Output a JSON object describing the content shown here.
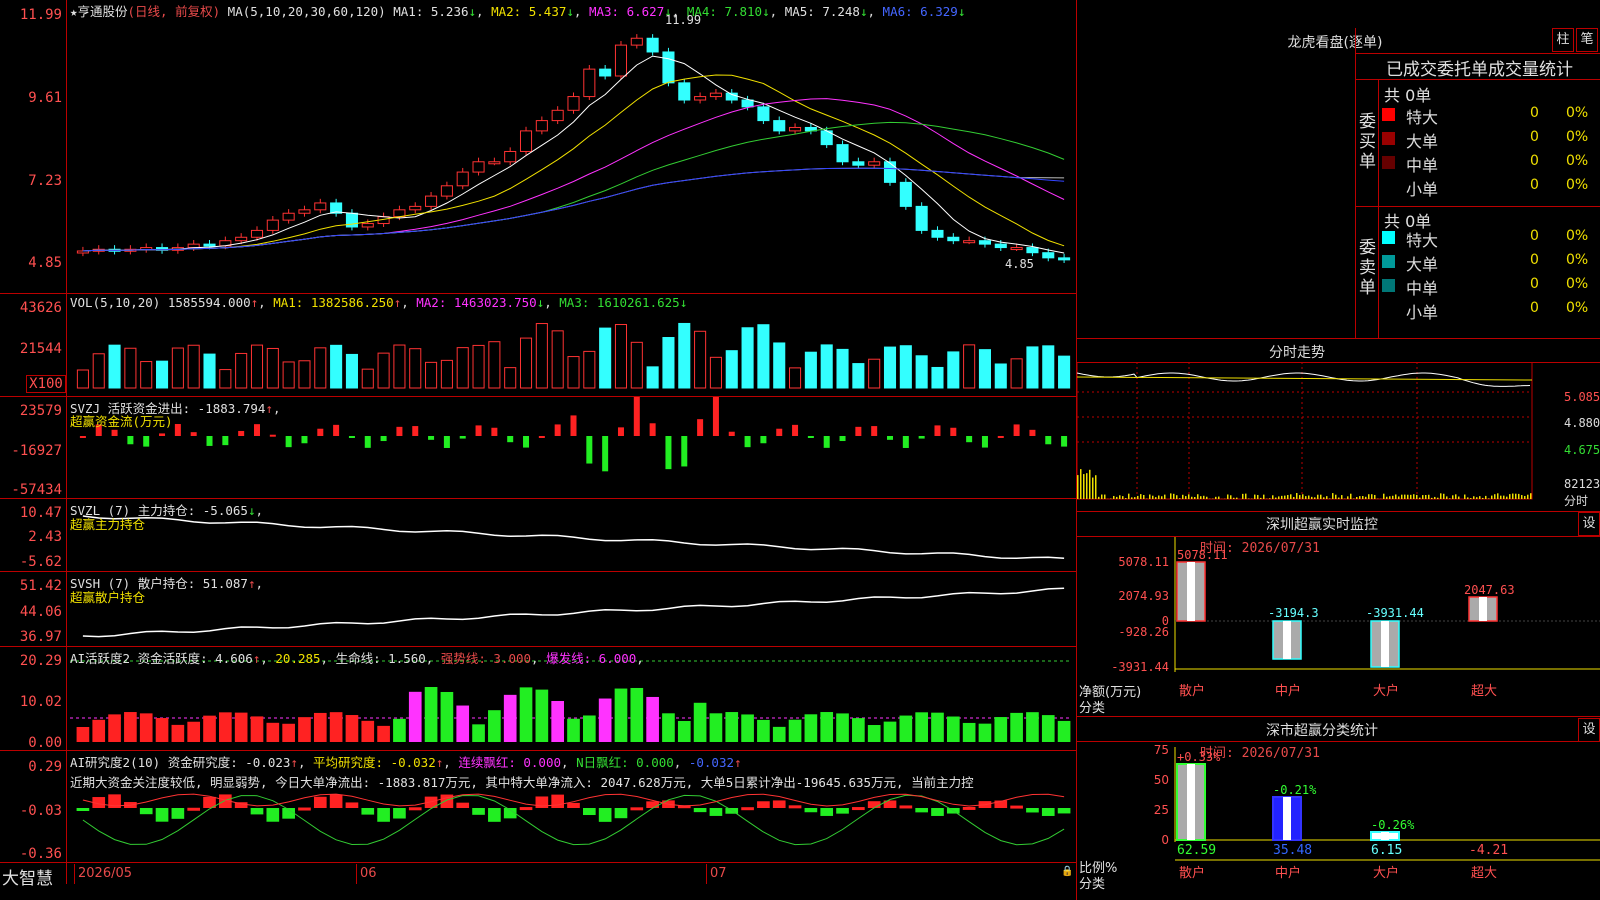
{
  "stock": {
    "name": "★亨通股份",
    "mode": "(日线, 前复权)"
  },
  "ma": {
    "label": "MA(5,10,20,30,60,120)",
    "ma1": "MA1: 5.236",
    "ma2": "MA2: 5.437",
    "ma3": "MA3: 6.627",
    "ma4": "MA4: 7.810",
    "ma5": "MA5: 7.248",
    "ma6": "MA6: 6.329",
    "high_mark": "11.99",
    "low_mark": "4.85"
  },
  "price_axis": [
    "11.99",
    "9.61",
    "7.23",
    "4.85"
  ],
  "vol": {
    "label": "VOL(5,10,20)",
    "val": "1585594.000",
    "ma1": "MA1: 1382586.250",
    "ma2": "MA2: 1463023.750",
    "ma3": "MA3: 1610261.625",
    "axis": [
      "43626",
      "21544",
      "X100"
    ]
  },
  "svzj": {
    "label": "SVZJ  活跃资金进出: -1883.794",
    "sub": "超赢资金流(万元)",
    "axis": [
      "23579",
      "-16927",
      "-57434"
    ]
  },
  "svzl": {
    "label": "SVZL (7) 主力持仓: -5.065",
    "sub": "超赢主力持仓",
    "axis": [
      "10.47",
      "2.43",
      "-5.62"
    ]
  },
  "svsh": {
    "label": "SVSH (7) 散户持仓: 51.087",
    "sub": "超赢散户持仓",
    "axis": [
      "51.42",
      "44.06",
      "36.97"
    ]
  },
  "ai1": {
    "label": "AI活跃度2 资金活跃度: 4.606",
    "v2": "20.285",
    "v3": "生命线: 1.560",
    "v4": "强势线: 3.000",
    "v5": "爆发线: 6.000",
    "axis": [
      "20.29",
      "10.02",
      "0.00"
    ]
  },
  "ai2": {
    "label": "AI研究度2(10) 资金研究度: -0.023",
    "v2": "平均研究度: -0.032",
    "v3": "连续飘红: 0.000",
    "v4": "N日飘红: 0.000",
    "v5": "-0.032",
    "axis": [
      "0.29",
      "-0.03",
      "-0.36"
    ],
    "comment": "近期大资金关注度较低, 明显弱势, 今日大单净流出: -1883.817万元, 其中特大单净流入: 2047.628万元, 大单5日累计净出-19645.635万元, 当前主力控"
  },
  "footer": {
    "brand": "大智慧",
    "d1": "2026/05",
    "d2": "06",
    "d3": "07"
  },
  "lhkp": {
    "title": "龙虎看盘(逐单)",
    "btn1": "柱",
    "btn2": "笔",
    "subtitle": "已成交委托单成交量统计",
    "buy": {
      "label": "委买单",
      "total": "共 0单",
      "rows": [
        {
          "name": "特大",
          "v": "0",
          "p": "0%",
          "color": "#ff0000"
        },
        {
          "name": "大单",
          "v": "0",
          "p": "0%",
          "color": "#990000"
        },
        {
          "name": "中单",
          "v": "0",
          "p": "0%",
          "color": "#660000"
        },
        {
          "name": "小单",
          "v": "0",
          "p": "0%",
          "color": "#000000"
        }
      ]
    },
    "sell": {
      "label": "委卖单",
      "total": "共 0单",
      "rows": [
        {
          "name": "特大",
          "v": "0",
          "p": "0%",
          "color": "#00ffff"
        },
        {
          "name": "大单",
          "v": "0",
          "p": "0%",
          "color": "#009999"
        },
        {
          "name": "中单",
          "v": "0",
          "p": "0%",
          "color": "#007777"
        },
        {
          "name": "小单",
          "v": "0",
          "p": "0%",
          "color": "#000000"
        }
      ]
    }
  },
  "fenshi": {
    "title": "分时走势",
    "axis": [
      "5.085",
      "4.880",
      "4.675",
      "82123",
      "分时"
    ]
  },
  "sz_monitor": {
    "title": "深圳超赢实时监控",
    "btn": "设",
    "time": "时间: 2026/07/31",
    "axis": [
      "5078.11",
      "2074.93",
      "0",
      "-928.26",
      "-3931.44"
    ],
    "ylabel": "净额(万元)",
    "xlabel": "分类",
    "bars": [
      {
        "cat": "散户",
        "val": "5078.11"
      },
      {
        "cat": "中户",
        "val": "-3194.3"
      },
      {
        "cat": "大户",
        "val": "-3931.44"
      },
      {
        "cat": "超大",
        "val": "2047.63"
      }
    ]
  },
  "sz_class": {
    "title": "深市超赢分类统计",
    "btn": "设",
    "time": "时间: 2026/07/31",
    "axis": [
      "75",
      "50",
      "25",
      "0"
    ],
    "ylabel": "比例%",
    "xlabel": "分类",
    "bars": [
      {
        "cat": "散户",
        "top": "+0.33%",
        "bottom": "62.59"
      },
      {
        "cat": "中户",
        "top": "-0.21%",
        "bottom": "35.48"
      },
      {
        "cat": "大户",
        "top": "-0.26%",
        "bottom": "6.15"
      },
      {
        "cat": "超大",
        "top": "",
        "bottom": "-4.21"
      }
    ]
  },
  "chart_data": [
    {
      "type": "candlestick",
      "title": "亨通股份 日线",
      "ylim": [
        4.85,
        11.99
      ],
      "series": [
        {
          "name": "MA1",
          "last": 5.236
        },
        {
          "name": "MA2",
          "last": 5.437
        },
        {
          "name": "MA3",
          "last": 6.627
        },
        {
          "name": "MA4",
          "last": 7.81
        },
        {
          "name": "MA5",
          "last": 7.248
        },
        {
          "name": "MA6",
          "last": 6.329
        }
      ]
    },
    {
      "type": "bar",
      "title": "VOL",
      "ylim": [
        0,
        43626
      ]
    }
  ]
}
